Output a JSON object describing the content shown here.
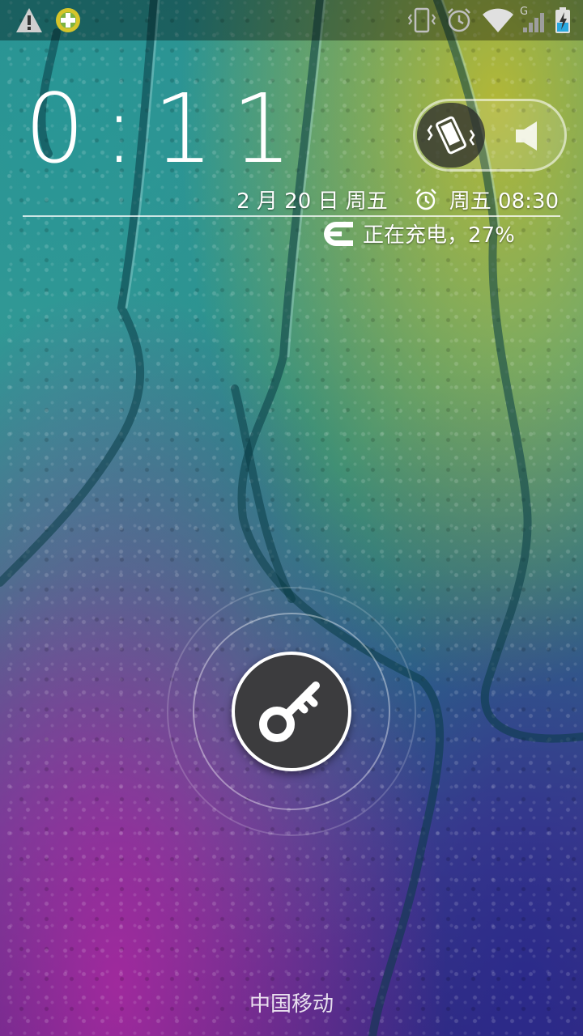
{
  "status_bar": {
    "icons": [
      "warning-icon",
      "app-notification-icon",
      "vibrate-icon",
      "alarm-icon",
      "wifi-icon",
      "signal-icon",
      "battery-charging-icon"
    ],
    "network_type": "G"
  },
  "lockscreen": {
    "time": "0:11",
    "date": "2 月 20 日 周五",
    "alarm": "周五 08:30",
    "charging_status": "正在充电，27%",
    "sound_toggle": {
      "left_icon": "vibrate-icon",
      "right_icon": "speaker-icon"
    },
    "unlock_icon": "key-icon",
    "carrier": "中国移动"
  },
  "colors": {
    "knob": "#3c3c3e",
    "accent_battery": "#29a8e0"
  }
}
